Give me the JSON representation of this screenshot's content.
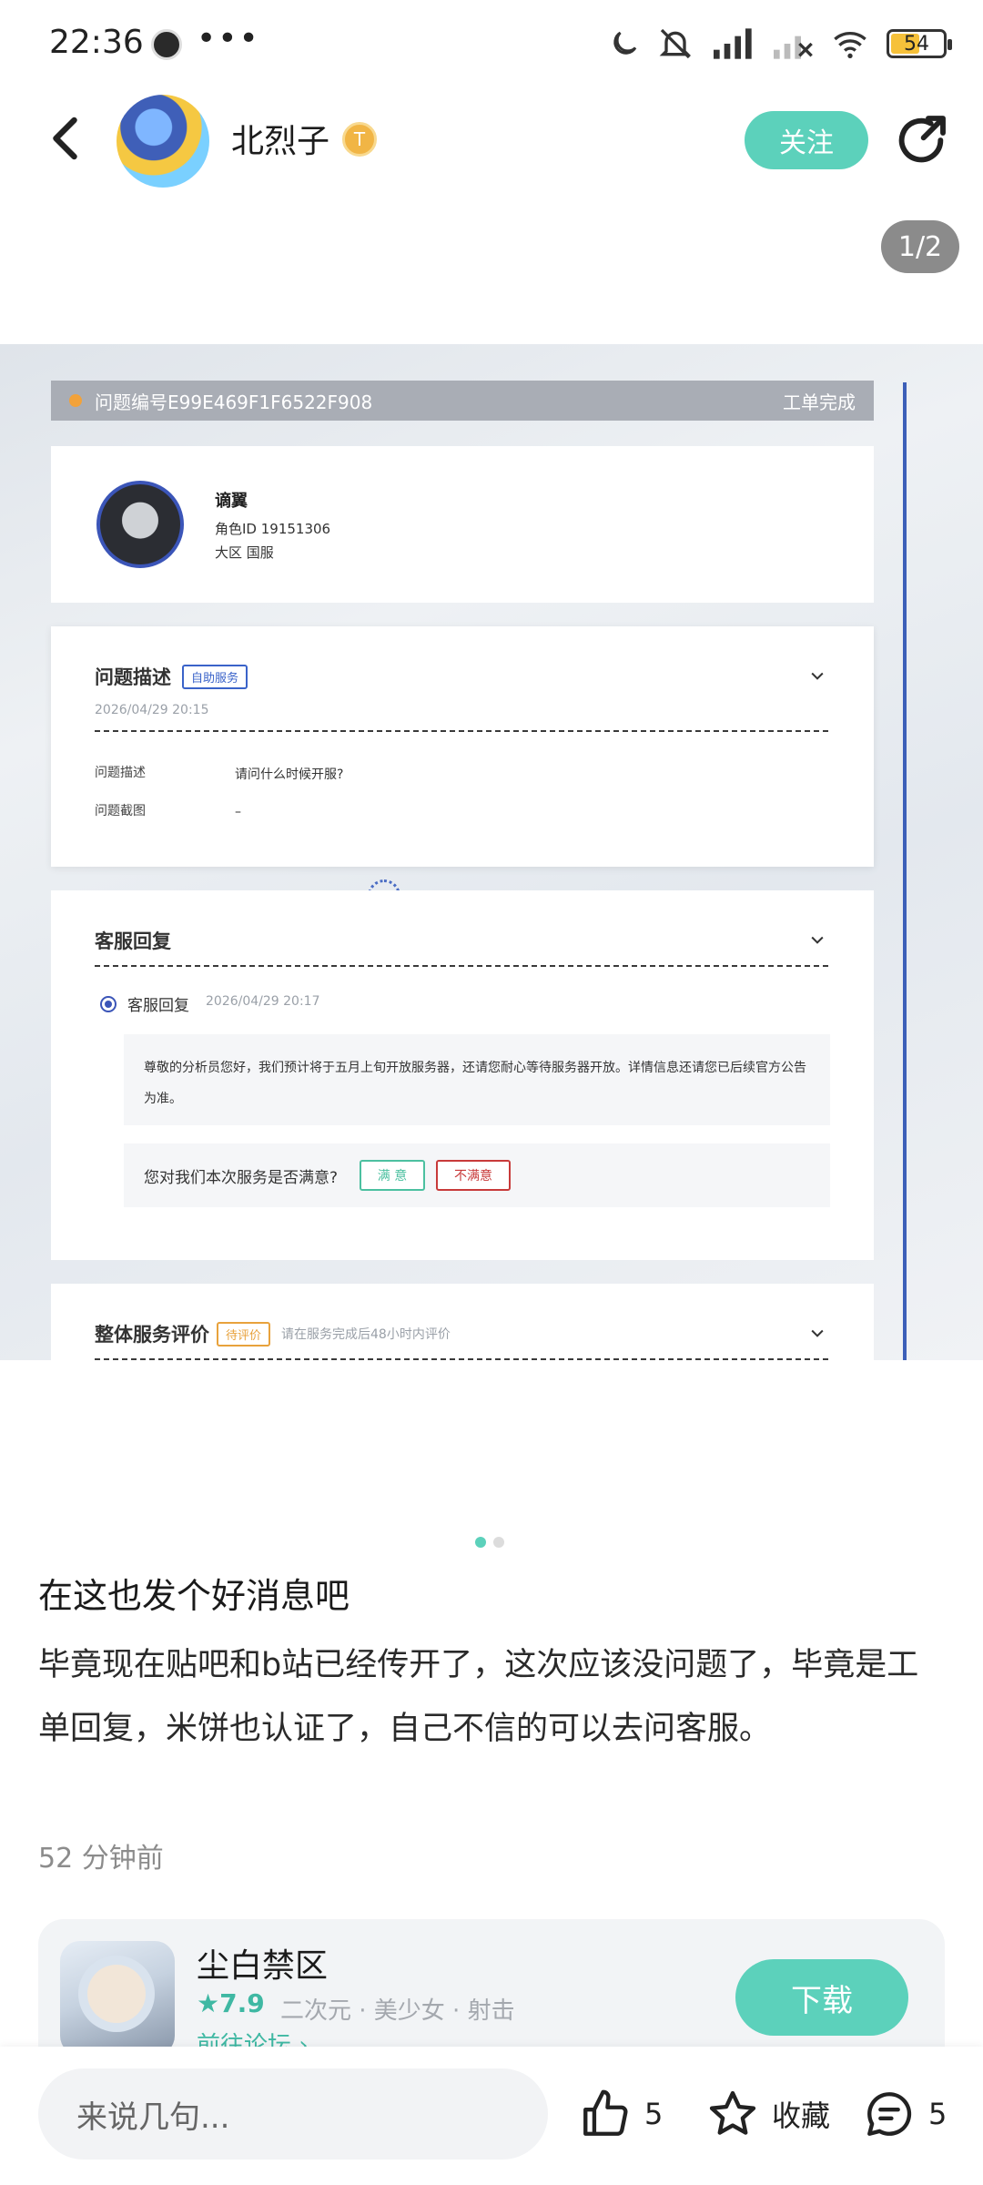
{
  "status_bar": {
    "time": "22:36",
    "more": "•••",
    "battery": "54"
  },
  "header": {
    "author": "北烈子",
    "badge": "T",
    "follow": "关注"
  },
  "carousel": {
    "counter": "1/2",
    "active_index": 0,
    "total": 2
  },
  "ticket": {
    "id_line": "问题编号E99E469F1F6522F908",
    "status": "工单完成",
    "user": {
      "name": "谪翼",
      "role_id": "角色ID  19151306",
      "region": "大区  国服"
    },
    "desc": {
      "title": "问题描述",
      "tag": "自助服务",
      "date": "2026/04/29 20:15",
      "label_desc": "问题描述",
      "value_desc": "请问什么时候开服?",
      "label_shot": "问题截图",
      "value_shot": "–"
    },
    "reply": {
      "title": "客服回复",
      "label": "客服回复",
      "date": "2026/04/29 20:17",
      "text": "尊敬的分析员您好，我们预计将于五月上旬开放服务器，还请您耐心等待服务器开放。详情信息还请您已后续官方公告为准。",
      "question": "您对我们本次服务是否满意?",
      "good": "满 意",
      "bad": "不满意"
    },
    "overall": {
      "title": "整体服务评价",
      "tag": "待评价",
      "hint": "请在服务完成后48小时内评价"
    }
  },
  "post": {
    "title": "在这也发个好消息吧",
    "body": "毕竟现在贴吧和b站已经传开了，这次应该没问题了，毕竟是工单回复，米饼也认证了，自己不信的可以去问客服。",
    "time": "52 分钟前"
  },
  "game": {
    "name": "尘白禁区",
    "rating": "★7.9",
    "tags": "二次元 · 美少女 · 射击",
    "forum": "前往论坛 ›",
    "download": "下载"
  },
  "bottom": {
    "placeholder": "来说几句...",
    "likes": "5",
    "favorite": "收藏",
    "comments": "5"
  },
  "colors": {
    "accent": "#5cd1bb",
    "ticket_blue": "#3b55b8"
  }
}
